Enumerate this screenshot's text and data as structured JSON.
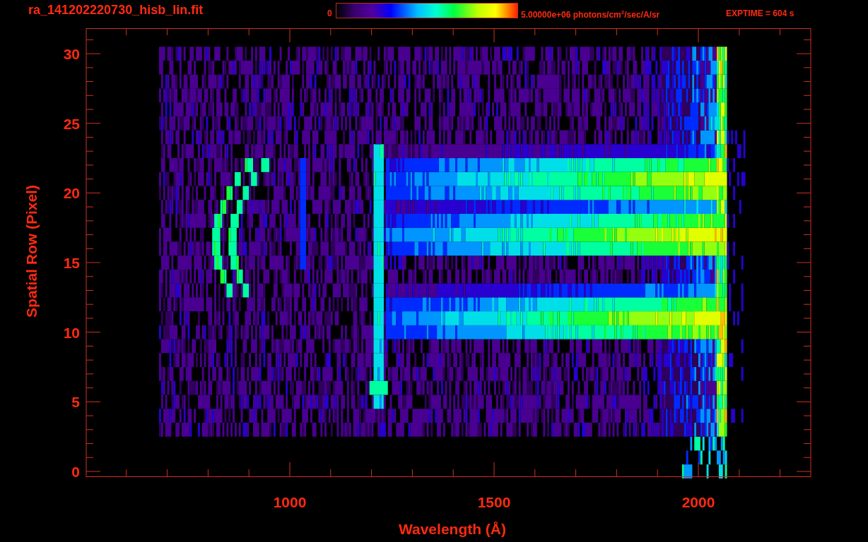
{
  "header": {
    "title": "ra_141202220730_hisb_lin.fit",
    "colorbar": {
      "min_label": "0",
      "max_label": "5.00000e+06 photons/cm$^{2}$/sec/A/sr"
    },
    "exposure": "EXPTIME = 604 s"
  },
  "plot": {
    "x_axis": {
      "label": "Wavelength (Å)",
      "ticks": [
        "1000",
        "1500",
        "2000"
      ]
    },
    "y_axis": {
      "label": "Spatial Row (Pixel)",
      "ticks": [
        "30",
        "25",
        "20",
        "15",
        "10",
        "5",
        "0"
      ]
    }
  }
}
